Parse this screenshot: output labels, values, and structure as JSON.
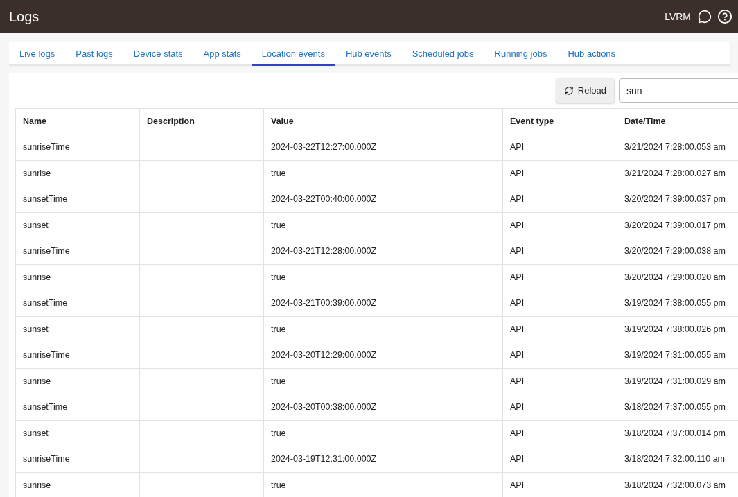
{
  "header": {
    "title": "Logs",
    "user": "LVRM"
  },
  "tabs": [
    {
      "label": "Live logs",
      "selected": false
    },
    {
      "label": "Past logs",
      "selected": false
    },
    {
      "label": "Device stats",
      "selected": false
    },
    {
      "label": "App stats",
      "selected": false
    },
    {
      "label": "Location events",
      "selected": true
    },
    {
      "label": "Hub events",
      "selected": false
    },
    {
      "label": "Scheduled jobs",
      "selected": false
    },
    {
      "label": "Running jobs",
      "selected": false
    },
    {
      "label": "Hub actions",
      "selected": false
    }
  ],
  "toolbar": {
    "reload": "Reload",
    "search": {
      "value": "sun"
    }
  },
  "table": {
    "columns": [
      "Name",
      "Description",
      "Value",
      "Event type",
      "Date/Time"
    ],
    "rows": [
      [
        "sunriseTime",
        "",
        "2024-03-22T12:27:00.000Z",
        "API",
        "3/21/2024 7:28:00.053 am"
      ],
      [
        "sunrise",
        "",
        "true",
        "API",
        "3/21/2024 7:28:00.027 am"
      ],
      [
        "sunsetTime",
        "",
        "2024-03-22T00:40:00.000Z",
        "API",
        "3/20/2024 7:39:00.037 pm"
      ],
      [
        "sunset",
        "",
        "true",
        "API",
        "3/20/2024 7:39:00.017 pm"
      ],
      [
        "sunriseTime",
        "",
        "2024-03-21T12:28:00.000Z",
        "API",
        "3/20/2024 7:29:00.038 am"
      ],
      [
        "sunrise",
        "",
        "true",
        "API",
        "3/20/2024 7:29:00.020 am"
      ],
      [
        "sunsetTime",
        "",
        "2024-03-21T00:39:00.000Z",
        "API",
        "3/19/2024 7:38:00.055 pm"
      ],
      [
        "sunset",
        "",
        "true",
        "API",
        "3/19/2024 7:38:00.026 pm"
      ],
      [
        "sunriseTime",
        "",
        "2024-03-20T12:29:00.000Z",
        "API",
        "3/19/2024 7:31:00.055 am"
      ],
      [
        "sunrise",
        "",
        "true",
        "API",
        "3/19/2024 7:31:00.029 am"
      ],
      [
        "sunsetTime",
        "",
        "2024-03-20T00:38:00.000Z",
        "API",
        "3/18/2024 7:37:00.055 pm"
      ],
      [
        "sunset",
        "",
        "true",
        "API",
        "3/18/2024 7:37:00.014 pm"
      ],
      [
        "sunriseTime",
        "",
        "2024-03-19T12:31:00.000Z",
        "API",
        "3/18/2024 7:32:00.110 am"
      ],
      [
        "sunrise",
        "",
        "true",
        "API",
        "3/18/2024 7:32:00.073 am"
      ]
    ]
  }
}
